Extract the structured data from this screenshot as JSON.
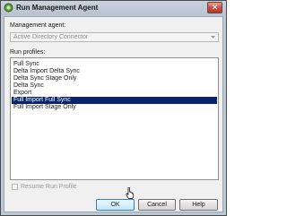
{
  "window": {
    "title": "Run Management Agent",
    "close_glyph": "✕"
  },
  "agent": {
    "label": "Management agent:",
    "value": "Active Directory Connector"
  },
  "profiles": {
    "label": "Run profiles:",
    "items": [
      {
        "label": "Full Sync",
        "selected": false
      },
      {
        "label": "Delta Import Delta Sync",
        "selected": false
      },
      {
        "label": "Delta Sync Stage Only",
        "selected": false
      },
      {
        "label": "Delta Sync",
        "selected": false
      },
      {
        "label": "Export",
        "selected": false
      },
      {
        "label": "Full Import Full Sync",
        "selected": true
      },
      {
        "label": "Full Import Stage Only",
        "selected": false
      }
    ]
  },
  "resume": {
    "label": "Resume Run Profile",
    "checked": false
  },
  "buttons": {
    "ok": "OK",
    "cancel": "Cancel",
    "help": "Help"
  },
  "colors": {
    "selection": "#0a246a",
    "close_button": "#c75040"
  }
}
